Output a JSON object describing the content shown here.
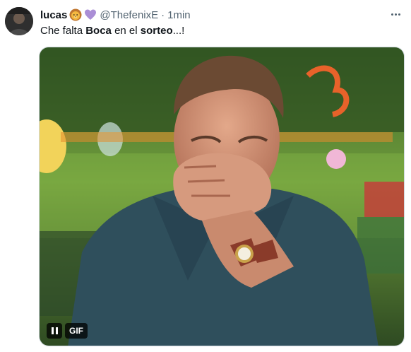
{
  "tweet": {
    "display_name": "lucas",
    "emojis": [
      "lion-face-emoji",
      "purple-heart-emoji"
    ],
    "handle": "@ThefenixE",
    "separator": "·",
    "timestamp": "1min",
    "text_parts": [
      {
        "text": "Che falta ",
        "bold": false
      },
      {
        "text": "Boca",
        "bold": true
      },
      {
        "text": " en el ",
        "bold": false
      },
      {
        "text": "sorteo",
        "bold": true
      },
      {
        "text": "...!",
        "bold": false
      }
    ],
    "media": {
      "type": "gif",
      "badge": "GIF",
      "controls": [
        "pause-icon"
      ]
    }
  },
  "colors": {
    "text_primary": "#0f1419",
    "text_secondary": "#536471",
    "purple_heart": "#aa8ed6"
  }
}
